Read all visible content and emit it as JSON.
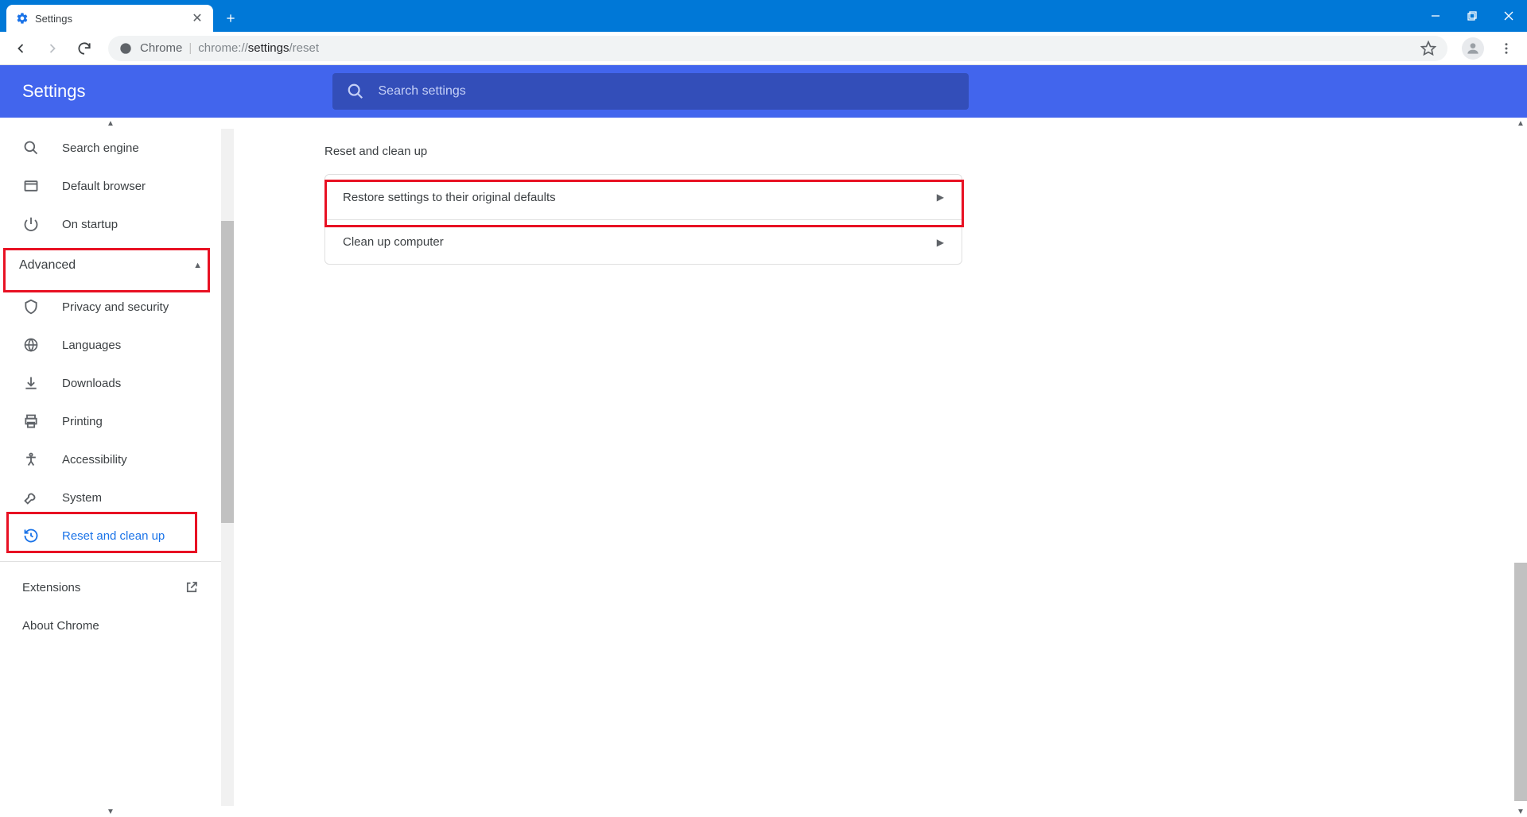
{
  "tab": {
    "title": "Settings"
  },
  "omnibox": {
    "label": "Chrome",
    "url_prefix": "chrome://",
    "url_main": "settings",
    "url_suffix": "/reset"
  },
  "header": {
    "title": "Settings",
    "search_placeholder": "Search settings"
  },
  "sidebar": {
    "items_top": [
      {
        "label": "Search engine"
      },
      {
        "label": "Default browser"
      },
      {
        "label": "On startup"
      }
    ],
    "advanced_label": "Advanced",
    "items_adv": [
      {
        "label": "Privacy and security"
      },
      {
        "label": "Languages"
      },
      {
        "label": "Downloads"
      },
      {
        "label": "Printing"
      },
      {
        "label": "Accessibility"
      },
      {
        "label": "System"
      },
      {
        "label": "Reset and clean up"
      }
    ],
    "extensions": "Extensions",
    "about": "About Chrome"
  },
  "main": {
    "section_title": "Reset and clean up",
    "rows": [
      {
        "label": "Restore settings to their original defaults"
      },
      {
        "label": "Clean up computer"
      }
    ]
  }
}
